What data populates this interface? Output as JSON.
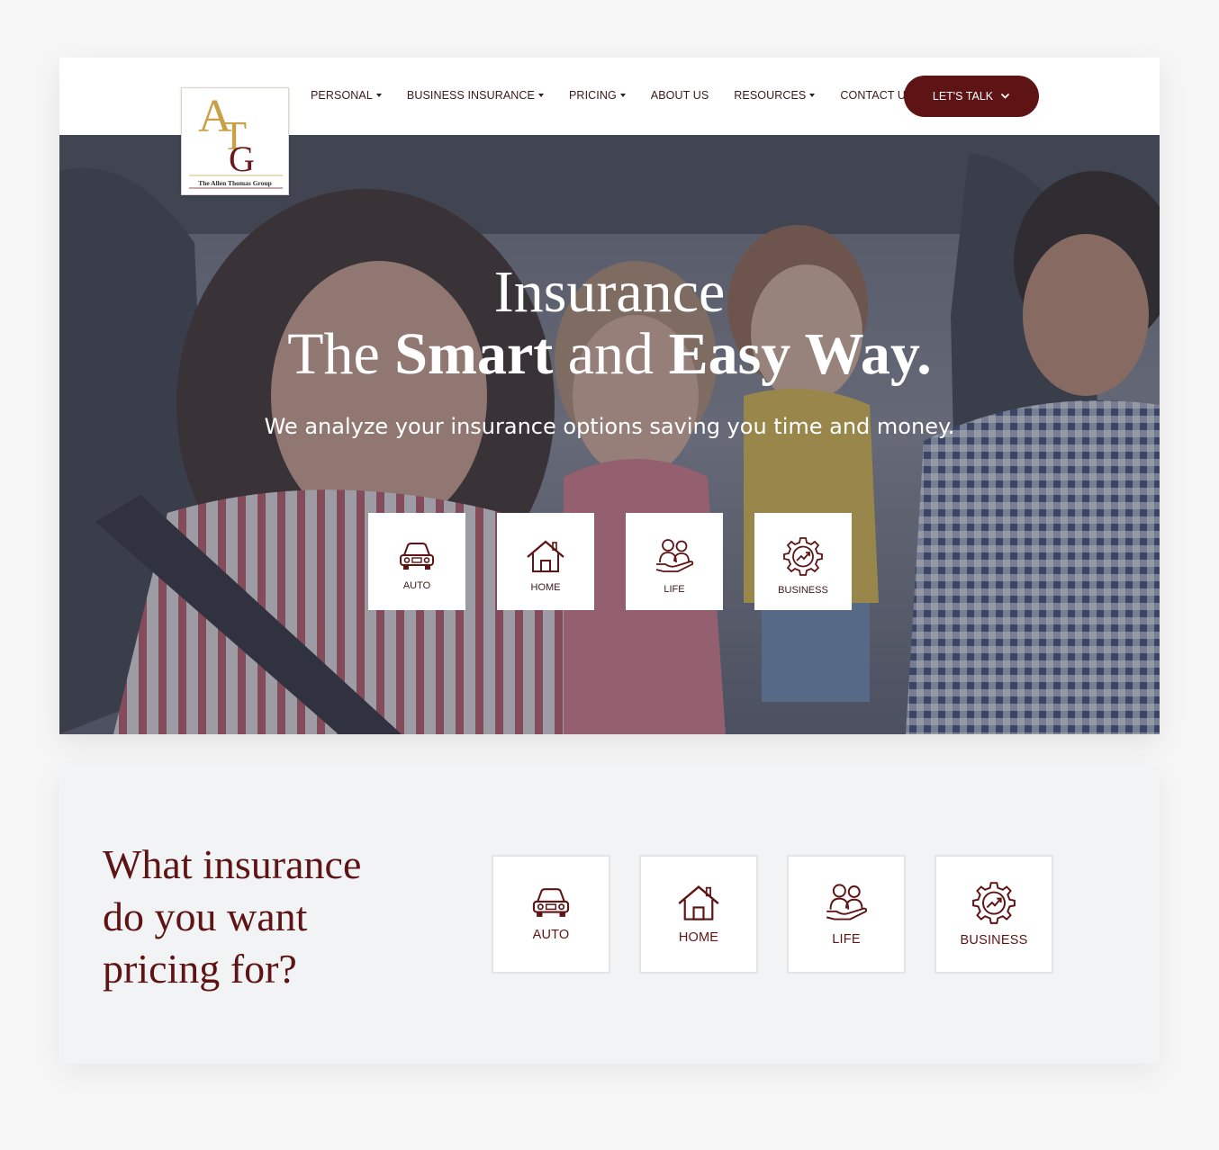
{
  "brand": {
    "logo_caption": "The Allen Thomas Group",
    "logo_monogram": "ATG",
    "primary_color": "#5e1314",
    "gold_color": "#c8a048"
  },
  "nav": {
    "items": [
      {
        "label": "PERSONAL",
        "dropdown": true
      },
      {
        "label": "BUSINESS INSURANCE",
        "dropdown": true
      },
      {
        "label": "PRICING",
        "dropdown": true
      },
      {
        "label": "ABOUT US",
        "dropdown": false
      },
      {
        "label": "RESOURCES",
        "dropdown": true
      },
      {
        "label": "CONTACT US",
        "dropdown": false
      }
    ],
    "cta_label": "LET'S TALK",
    "cta_icon": "chevron-down-icon"
  },
  "hero": {
    "line1": "Insurance",
    "line2_a": "The ",
    "line2_b": "Smart",
    "line2_c": " and ",
    "line2_d": "Easy Way.",
    "subtitle": "We analyze your insurance options saving you time and money.",
    "tiles": [
      {
        "label": "AUTO",
        "icon": "car-icon"
      },
      {
        "label": "HOME",
        "icon": "house-icon"
      },
      {
        "label": "LIFE",
        "icon": "family-hand-icon"
      },
      {
        "label": "BUSINESS",
        "icon": "gear-chart-icon"
      }
    ]
  },
  "pricing": {
    "heading": "What insurance do you want pricing for?",
    "tiles": [
      {
        "label": "AUTO",
        "icon": "car-icon"
      },
      {
        "label": "HOME",
        "icon": "house-icon"
      },
      {
        "label": "LIFE",
        "icon": "family-hand-icon"
      },
      {
        "label": "BUSINESS",
        "icon": "gear-chart-icon"
      }
    ]
  }
}
